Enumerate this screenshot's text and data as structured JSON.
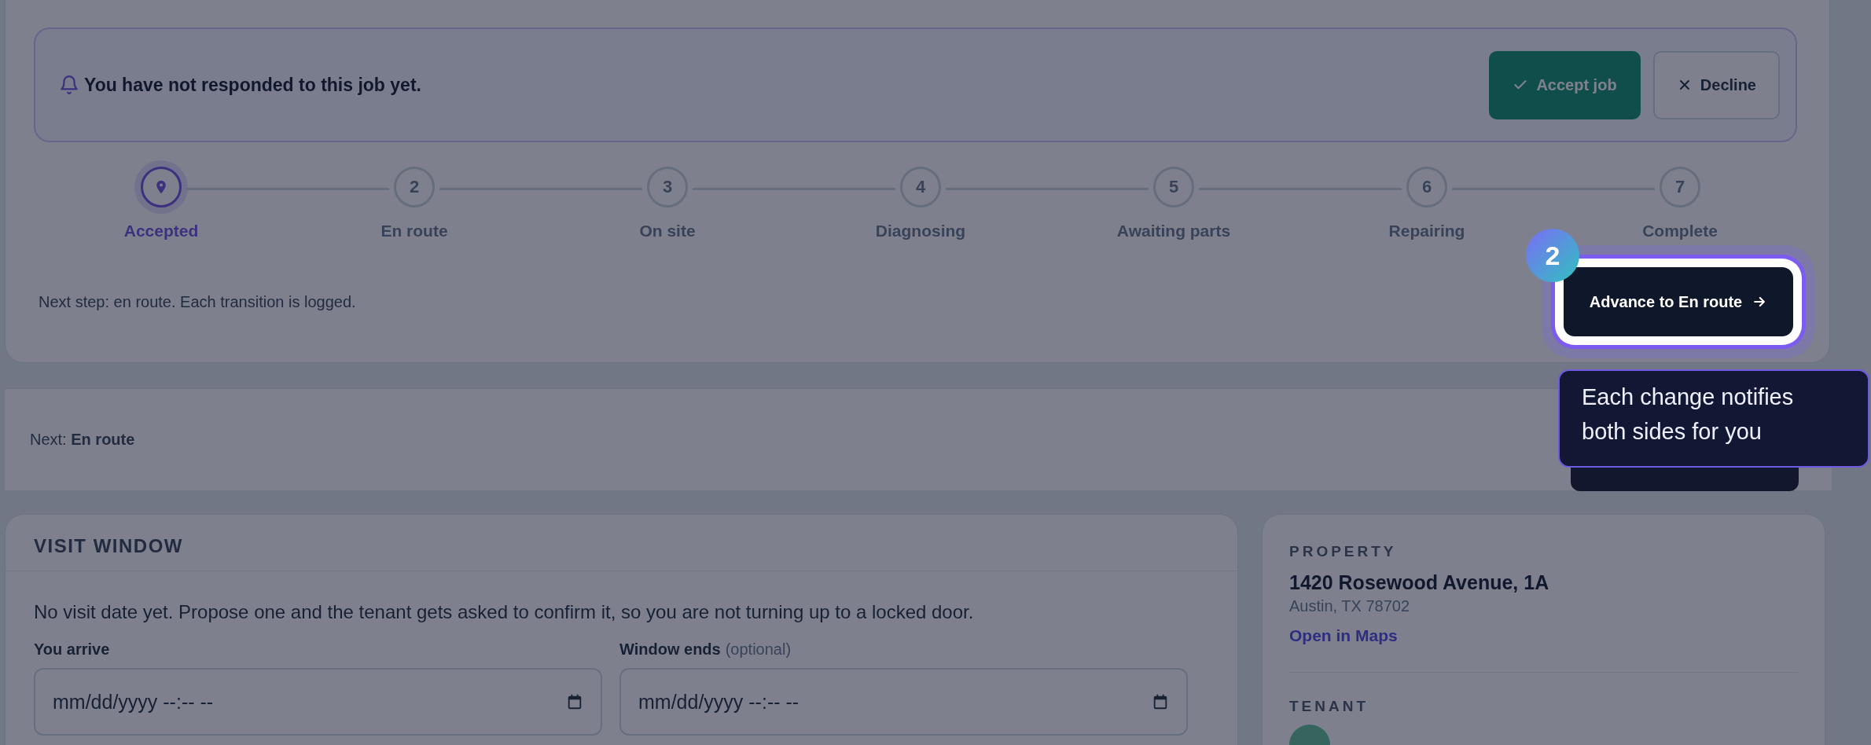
{
  "job_response": {
    "message": "You have not responded to this job yet.",
    "buttons": [
      {
        "kind": "accept",
        "label": "Accept job"
      },
      {
        "kind": "decline",
        "label": "Decline"
      }
    ]
  },
  "stepper": {
    "steps": [
      {
        "label": "Accepted",
        "selected": true
      },
      {
        "number": "2",
        "label": "En route",
        "selected": false
      },
      {
        "number": "3",
        "label": "On site",
        "selected": false
      },
      {
        "number": "4",
        "label": "Diagnosing",
        "selected": false
      },
      {
        "number": "5",
        "label": "Awaiting parts",
        "selected": false
      },
      {
        "number": "6",
        "label": "Repairing",
        "selected": false
      },
      {
        "number": "7",
        "label": "Complete",
        "selected": false
      }
    ],
    "note": "Next step: en route. Each transition is logged.",
    "advance_button": "Advance to En route"
  },
  "tour": {
    "step_badge": "2",
    "tooltip": "Each change notifies both sides for you"
  },
  "next_bar": {
    "text": "Next: **En route**"
  },
  "visit_window": {
    "title": "VISIT WINDOW",
    "description": "No visit date yet. Propose one and the tenant gets asked to confirm it, so you are not turning up to a locked door.",
    "fields": [
      {
        "label": "You arrive",
        "placeholder": "mm/dd/yyyy --:-- --"
      },
      {
        "label": "Window ends",
        "hint": "(optional)",
        "placeholder": "mm/dd/yyyy --:-- --"
      }
    ]
  },
  "property": {
    "title": "PROPERTY",
    "address": "1420 Rosewood Avenue, 1A",
    "city": "Austin, TX 78702",
    "link": "Open in Maps"
  },
  "tenant": {
    "title": "TENANT"
  }
}
